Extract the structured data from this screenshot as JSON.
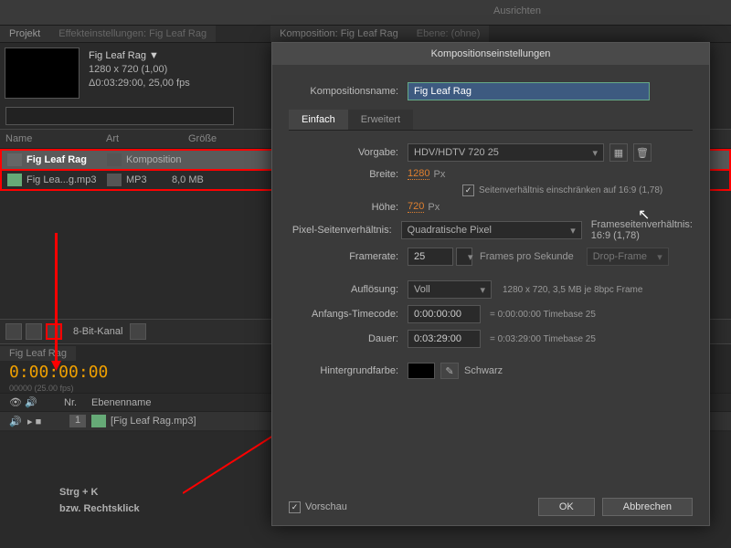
{
  "topbar": {
    "ausrichten": "Ausrichten"
  },
  "project": {
    "tab1": "Projekt",
    "tab2": "Effekteinstellungen: Fig Leaf Rag",
    "compTab": "Komposition: Fig Leaf Rag",
    "ebeneTab": "Ebene: (ohne)",
    "title": "Fig Leaf Rag ▼",
    "dims": "1280 x 720 (1,00)",
    "dur": "Δ0:03:29:00, 25,00 fps",
    "cols": {
      "name": "Name",
      "art": "Art",
      "size": "Größe"
    },
    "rows": [
      {
        "name": "Fig Leaf Rag",
        "type": "Komposition",
        "size": ""
      },
      {
        "name": "Fig Lea...g.mp3",
        "type": "MP3",
        "size": "8,0 MB"
      }
    ],
    "bitdepth": "8-Bit-Kanal"
  },
  "timeline": {
    "tab": "Fig Leaf Rag",
    "tc": "0:00:00:00",
    "tcsub": "00000 (25.00 fps)",
    "cols": {
      "nr": "Nr.",
      "name": "Ebenenname"
    },
    "layer": {
      "num": "1",
      "name": "[Fig Leaf Rag.mp3]"
    }
  },
  "annotation": {
    "l1": "Strg + K",
    "l2": "bzw. Rechtsklick"
  },
  "dlg": {
    "title": "Kompositionseinstellungen",
    "nameLbl": "Kompositionsname:",
    "nameVal": "Fig Leaf Rag",
    "tabs": {
      "simple": "Einfach",
      "adv": "Erweitert"
    },
    "preset": {
      "lbl": "Vorgabe:",
      "val": "HDV/HDTV 720 25"
    },
    "width": {
      "lbl": "Breite:",
      "val": "1280",
      "unit": "Px"
    },
    "height": {
      "lbl": "Höhe:",
      "val": "720",
      "unit": "Px"
    },
    "lockAspect": "Seitenverhältnis einschränken auf 16:9 (1,78)",
    "par": {
      "lbl": "Pixel-Seitenverhältnis:",
      "val": "Quadratische Pixel"
    },
    "farLbl": "Frameseitenverhältnis:",
    "farVal": "16:9 (1,78)",
    "fps": {
      "lbl": "Framerate:",
      "val": "25",
      "unit": "Frames pro Sekunde",
      "drop": "Drop-Frame"
    },
    "res": {
      "lbl": "Auflösung:",
      "val": "Voll",
      "info": "1280 x 720, 3,5 MB je 8bpc Frame"
    },
    "start": {
      "lbl": "Anfangs-Timecode:",
      "val": "0:00:00:00",
      "info": "= 0:00:00:00  Timebase 25"
    },
    "duration": {
      "lbl": "Dauer:",
      "val": "0:03:29:00",
      "info": "= 0:03:29:00  Timebase 25"
    },
    "bg": {
      "lbl": "Hintergrundfarbe:",
      "name": "Schwarz"
    },
    "preview": "Vorschau",
    "ok": "OK",
    "cancel": "Abbrechen"
  }
}
